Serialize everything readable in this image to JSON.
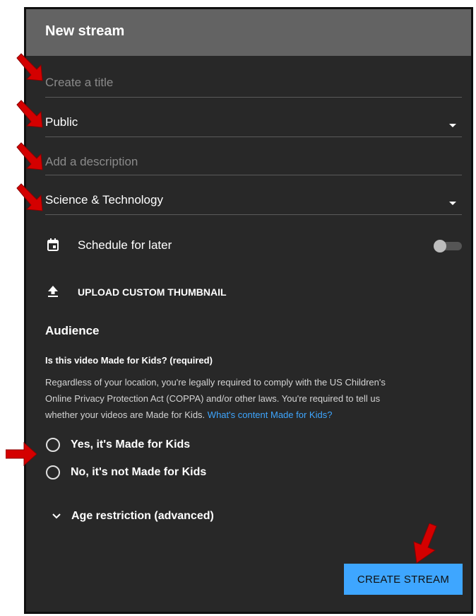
{
  "dialog": {
    "title": "New stream",
    "fields": {
      "title_placeholder": "Create a title",
      "visibility_value": "Public",
      "description_placeholder": "Add a description",
      "category_value": "Science & Technology"
    },
    "schedule": {
      "label": "Schedule for later",
      "enabled": false
    },
    "thumbnail": {
      "label": "UPLOAD CUSTOM THUMBNAIL"
    },
    "audience": {
      "title": "Audience",
      "question": "Is this video Made for Kids? (required)",
      "body_line1": "Regardless of your location, you're legally required to comply with the US Children's",
      "body_line2": "Online Privacy Protection Act (COPPA) and/or other laws. You're required to tell us",
      "body_line3": "whether your videos are Made for Kids.",
      "link": "What's content Made for Kids?",
      "options": [
        {
          "label": "Yes, it's Made for Kids",
          "selected": false
        },
        {
          "label": "No, it's not Made for Kids",
          "selected": false
        }
      ]
    },
    "age_restriction": {
      "label": "Age restriction (advanced)"
    },
    "create_button": {
      "label": "CREATE STREAM"
    }
  },
  "colors": {
    "dialog_bg": "#282828",
    "header_bg": "#636363",
    "accent": "#3ea6ff",
    "annotation_arrow": "#d40000"
  }
}
